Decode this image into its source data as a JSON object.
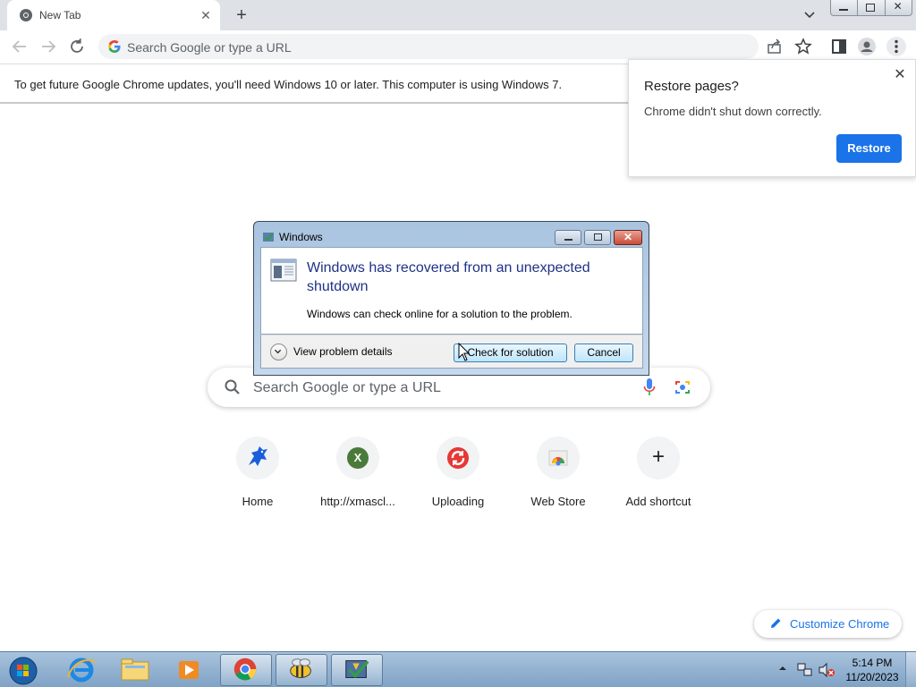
{
  "browser": {
    "tab_title": "New Tab",
    "new_tab_symbol": "+",
    "tab_close_symbol": "✕",
    "omnibox_placeholder": "Search Google or type a URL"
  },
  "infobar": {
    "message": "To get future Google Chrome updates, you'll need Windows 10 or later. This computer is using Windows 7."
  },
  "restore_bubble": {
    "title": "Restore pages?",
    "message": "Chrome didn't shut down correctly.",
    "button": "Restore",
    "close_symbol": "✕"
  },
  "ntp": {
    "search_placeholder": "Search Google or type a URL",
    "shortcuts": [
      {
        "label": "Home",
        "icon": "blue-dragon-icon"
      },
      {
        "label": "http://xmascl...",
        "icon": "x-letter-icon",
        "letter": "X"
      },
      {
        "label": "Uploading",
        "icon": "red-sync-icon"
      },
      {
        "label": "Web Store",
        "icon": "chrome-web-store-icon"
      },
      {
        "label": "Add shortcut",
        "icon": "plus-icon",
        "symbol": "+"
      }
    ],
    "customize_label": "Customize Chrome"
  },
  "dialog": {
    "window_title": "Windows",
    "headline": "Windows has recovered from an unexpected shutdown",
    "description": "Windows can check online for a solution to the problem.",
    "details_label": "View problem details",
    "check_button": "Check for solution",
    "cancel_button": "Cancel"
  },
  "taskbar": {
    "time": "5:14 PM",
    "date": "11/20/2023",
    "items": [
      "start-orb",
      "internet-explorer",
      "windows-explorer",
      "media-player",
      "chrome",
      "bee-app",
      "problem-reports"
    ]
  },
  "colors": {
    "accent": "#1a73e8",
    "dialog_headline": "#1e3287",
    "tab_strip": "#dee1e6"
  }
}
